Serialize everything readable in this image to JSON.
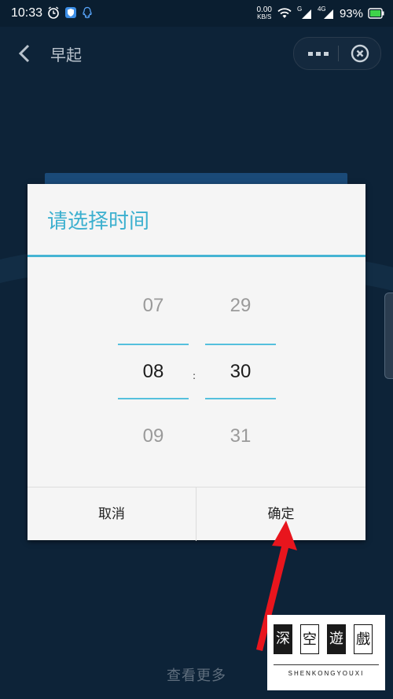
{
  "status_bar": {
    "time": "10:33",
    "net_speed_value": "0.00",
    "net_speed_unit": "KB/S",
    "signal_1_label": "G",
    "signal_2_label": "4G",
    "battery_percent": "93%"
  },
  "header": {
    "title": "早起"
  },
  "dialog": {
    "title": "请选择时间",
    "hour_prev": "07",
    "hour_selected": "08",
    "hour_next": "09",
    "minute_prev": "29",
    "minute_selected": "30",
    "minute_next": "31",
    "separator": ":",
    "cancel_label": "取消",
    "confirm_label": "确定"
  },
  "footer": {
    "more_link": "查看更多"
  },
  "watermark": {
    "chars": [
      "深",
      "空",
      "遊",
      "戲"
    ],
    "romanized": "SHENKONGYOUXI"
  },
  "colors": {
    "accent": "#3cb0cf",
    "background": "#0d2338",
    "dialog_bg": "#f5f5f5",
    "arrow": "#e8151d"
  }
}
